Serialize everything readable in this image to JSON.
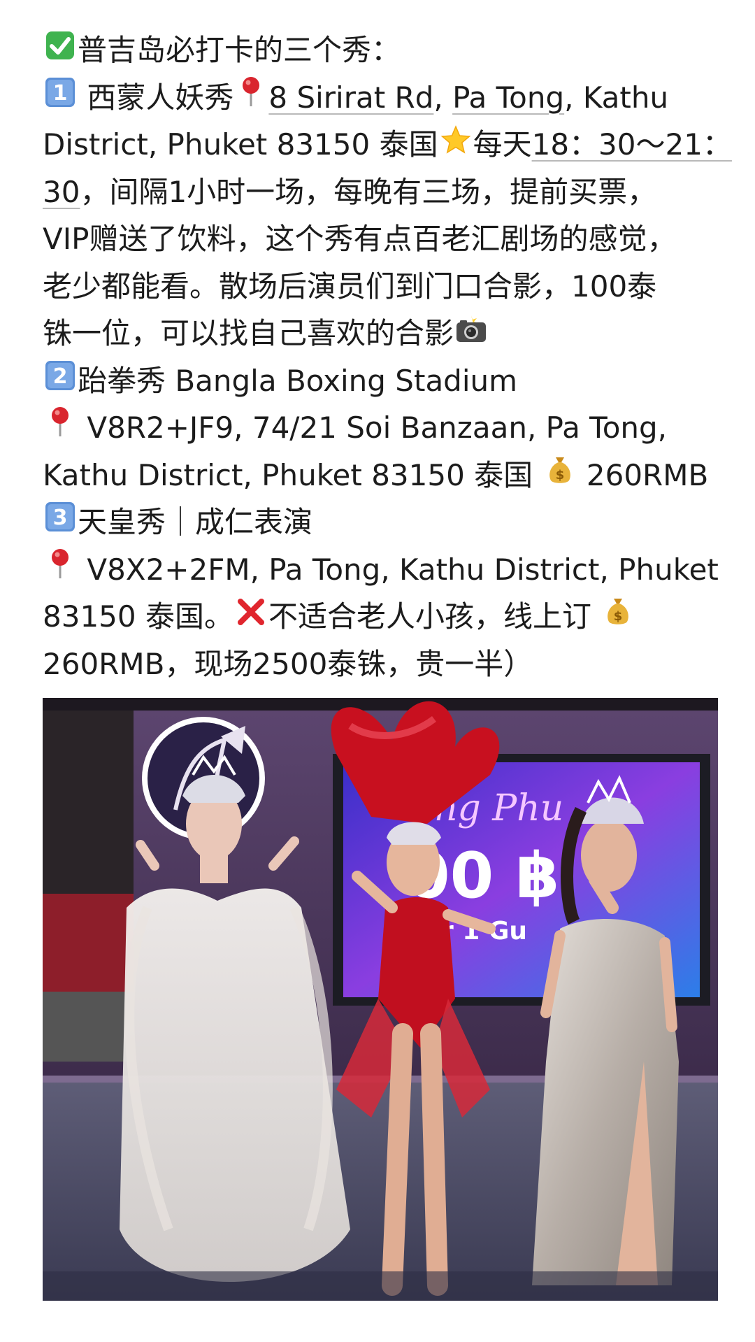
{
  "post": {
    "heading": {
      "icon": "check-mark-button-icon",
      "text": "普吉岛必打卡的三个秀："
    },
    "show1": {
      "number_icon": "keycap-1-icon",
      "name": "西蒙人妖秀",
      "pin_icon": "round-pushpin-icon",
      "address_part1": "8 Sirirat Rd",
      "address_sep1": ", ",
      "address_part2": "Pa Tong",
      "address_part3": ", Kathu",
      "address_line2": "District, Phuket 83150 泰国",
      "star_icon": "star-icon",
      "time_prefix": "每天",
      "time_part1": "18：30～21：",
      "time_part2": "30",
      "desc_line3_rest": "，间隔1小时一场，每晚有三场，提前买票，",
      "desc_line4": "VIP赠送了饮料，这个秀有点百老汇剧场的感觉，",
      "desc_line5": "老少都能看。散场后演员们到门口合影，100泰",
      "desc_line6": "铢一位，可以找自己喜欢的合影",
      "camera_icon": "camera-with-flash-icon"
    },
    "show2": {
      "number_icon": "keycap-2-icon",
      "name": "跆拳秀 Bangla Boxing Stadium",
      "pin_icon": "round-pushpin-icon",
      "address_line1": " V8R2+JF9, 74/21 Soi Banzaan, Pa Tong,",
      "address_line2": "Kathu District, Phuket 83150 泰国",
      "money_icon": "money-bag-icon",
      "price": " 260RMB"
    },
    "show3": {
      "number_icon": "keycap-3-icon",
      "name": "天皇秀｜成仁表演",
      "pin_icon": "round-pushpin-icon",
      "address_line1": " V8X2+2FM, Pa Tong, Kathu District, Phuket",
      "address_line2": "83150 泰国。",
      "cross_icon": "cross-mark-icon",
      "note": "不适合老人小孩，线上订",
      "money_icon": "money-bag-icon",
      "price_line": "260RMB，现场2500泰铢，贵一半）"
    }
  },
  "photo": {
    "sign_text": "ng Phu",
    "sign_price": "00 ฿",
    "sign_sub": "r 1 Gu"
  },
  "colors": {
    "text": "#1c1c1c",
    "keycap": "#5b8fd6",
    "check": "#3fb34f",
    "cross": "#e0262e",
    "pin": "#d9252e",
    "underline": "#b9b9b9"
  }
}
